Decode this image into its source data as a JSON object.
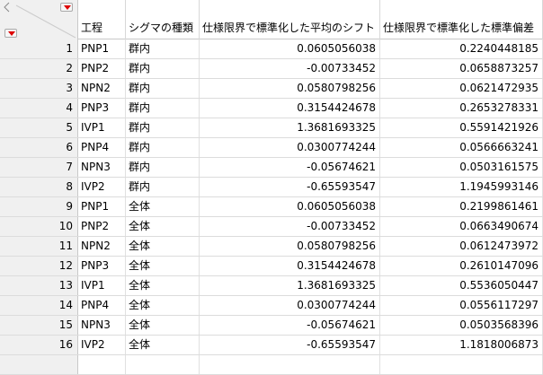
{
  "columns": [
    "工程",
    "シグマの種類",
    "仕様限界で標準化した平均のシフト",
    "仕様限界で標準化した標準偏差"
  ],
  "rows": [
    [
      "1",
      "PNP1",
      "群内",
      "0.0605056038",
      "0.2240448185"
    ],
    [
      "2",
      "PNP2",
      "群内",
      "-0.00733452",
      "0.0658873257"
    ],
    [
      "3",
      "NPN2",
      "群内",
      "0.0580798256",
      "0.0621472935"
    ],
    [
      "4",
      "PNP3",
      "群内",
      "0.3154424678",
      "0.2653278331"
    ],
    [
      "5",
      "IVP1",
      "群内",
      "1.3681693325",
      "0.5591421926"
    ],
    [
      "6",
      "PNP4",
      "群内",
      "0.0300774244",
      "0.0566663241"
    ],
    [
      "7",
      "NPN3",
      "群内",
      "-0.05674621",
      "0.0503161575"
    ],
    [
      "8",
      "IVP2",
      "群内",
      "-0.65593547",
      "1.1945993146"
    ],
    [
      "9",
      "PNP1",
      "全体",
      "0.0605056038",
      "0.2199861461"
    ],
    [
      "10",
      "PNP2",
      "全体",
      "-0.00733452",
      "0.0663490674"
    ],
    [
      "11",
      "NPN2",
      "全体",
      "0.0580798256",
      "0.0612473972"
    ],
    [
      "12",
      "PNP3",
      "全体",
      "0.3154424678",
      "0.2610147096"
    ],
    [
      "13",
      "IVP1",
      "全体",
      "1.3681693325",
      "0.5536050447"
    ],
    [
      "14",
      "PNP4",
      "全体",
      "0.0300774244",
      "0.0556117297"
    ],
    [
      "15",
      "NPN3",
      "全体",
      "-0.05674621",
      "0.0503568396"
    ],
    [
      "16",
      "IVP2",
      "全体",
      "-0.65593547",
      "1.1818006873"
    ]
  ]
}
